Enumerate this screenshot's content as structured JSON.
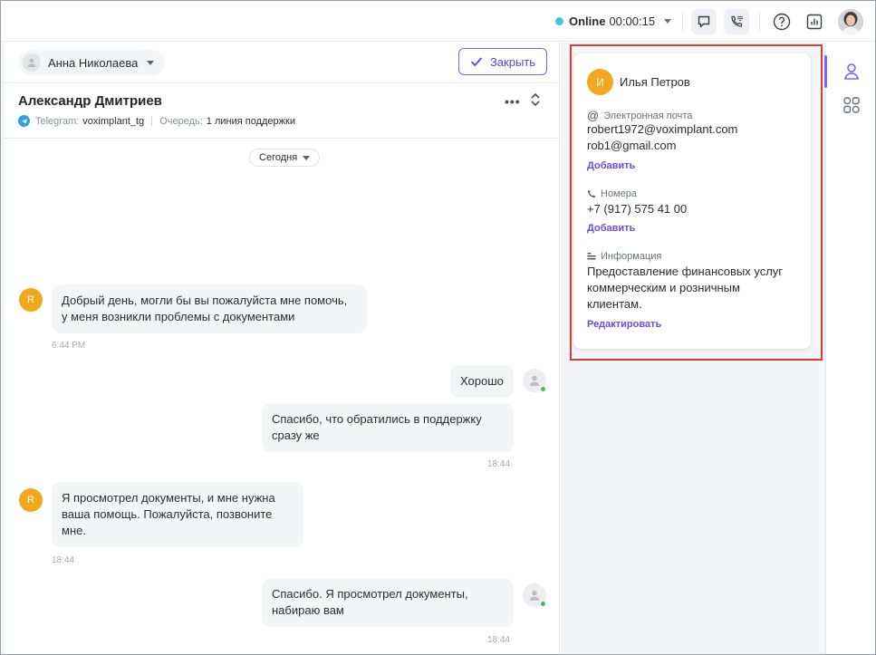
{
  "topbar": {
    "status_label": "Online",
    "status_timer": "00:00:15",
    "colors": {
      "accent": "#7b61ff",
      "status": "#3ec6e0"
    }
  },
  "chat": {
    "assignee": "Анна Николаева",
    "close_button": "Закрыть",
    "contact_name": "Александр Дмитриев",
    "channel_label": "Telegram:",
    "channel_value": "voximplant_tg",
    "queue_label": "Очередь:",
    "queue_value": "1 линия поддержки",
    "date_filter": "Сегодня",
    "messages": [
      {
        "avatar": "R",
        "text1": "Добрый день, могли бы вы пожалуйста мне помочь,",
        "text2": "у меня возникли проблемы с документами",
        "time": "6:44 PM"
      },
      {
        "text1": "Хорошо"
      },
      {
        "text1": "Спасибо, что обратились в поддержку",
        "text2": "сразу же",
        "time": "18:44"
      },
      {
        "avatar": "R",
        "text1": "Я просмотрел документы, и мне нужна",
        "text2": "ваша помощь. Пожалуйста, позвоните",
        "text3": "мне.",
        "time": "18:44"
      },
      {
        "text1": "Спасибо. Я просмотрел документы,",
        "text2": "набираю вам",
        "time": "18:44"
      }
    ]
  },
  "contact_card": {
    "avatar_letter": "И",
    "name": "Илья Петров",
    "email_label": "Электронная почта",
    "emails": [
      "robert1972@voximplant.com",
      "rob1@gmail.com"
    ],
    "email_add": "Добавить",
    "phone_label": "Номера",
    "phone": "+7 (917) 575 41 00",
    "phone_add": "Добавить",
    "info_label": "Информация",
    "info_lines": [
      "Предоставление финансовых услуг",
      "коммерческим и розничным",
      "клиентам."
    ],
    "info_edit": "Редактировать"
  }
}
